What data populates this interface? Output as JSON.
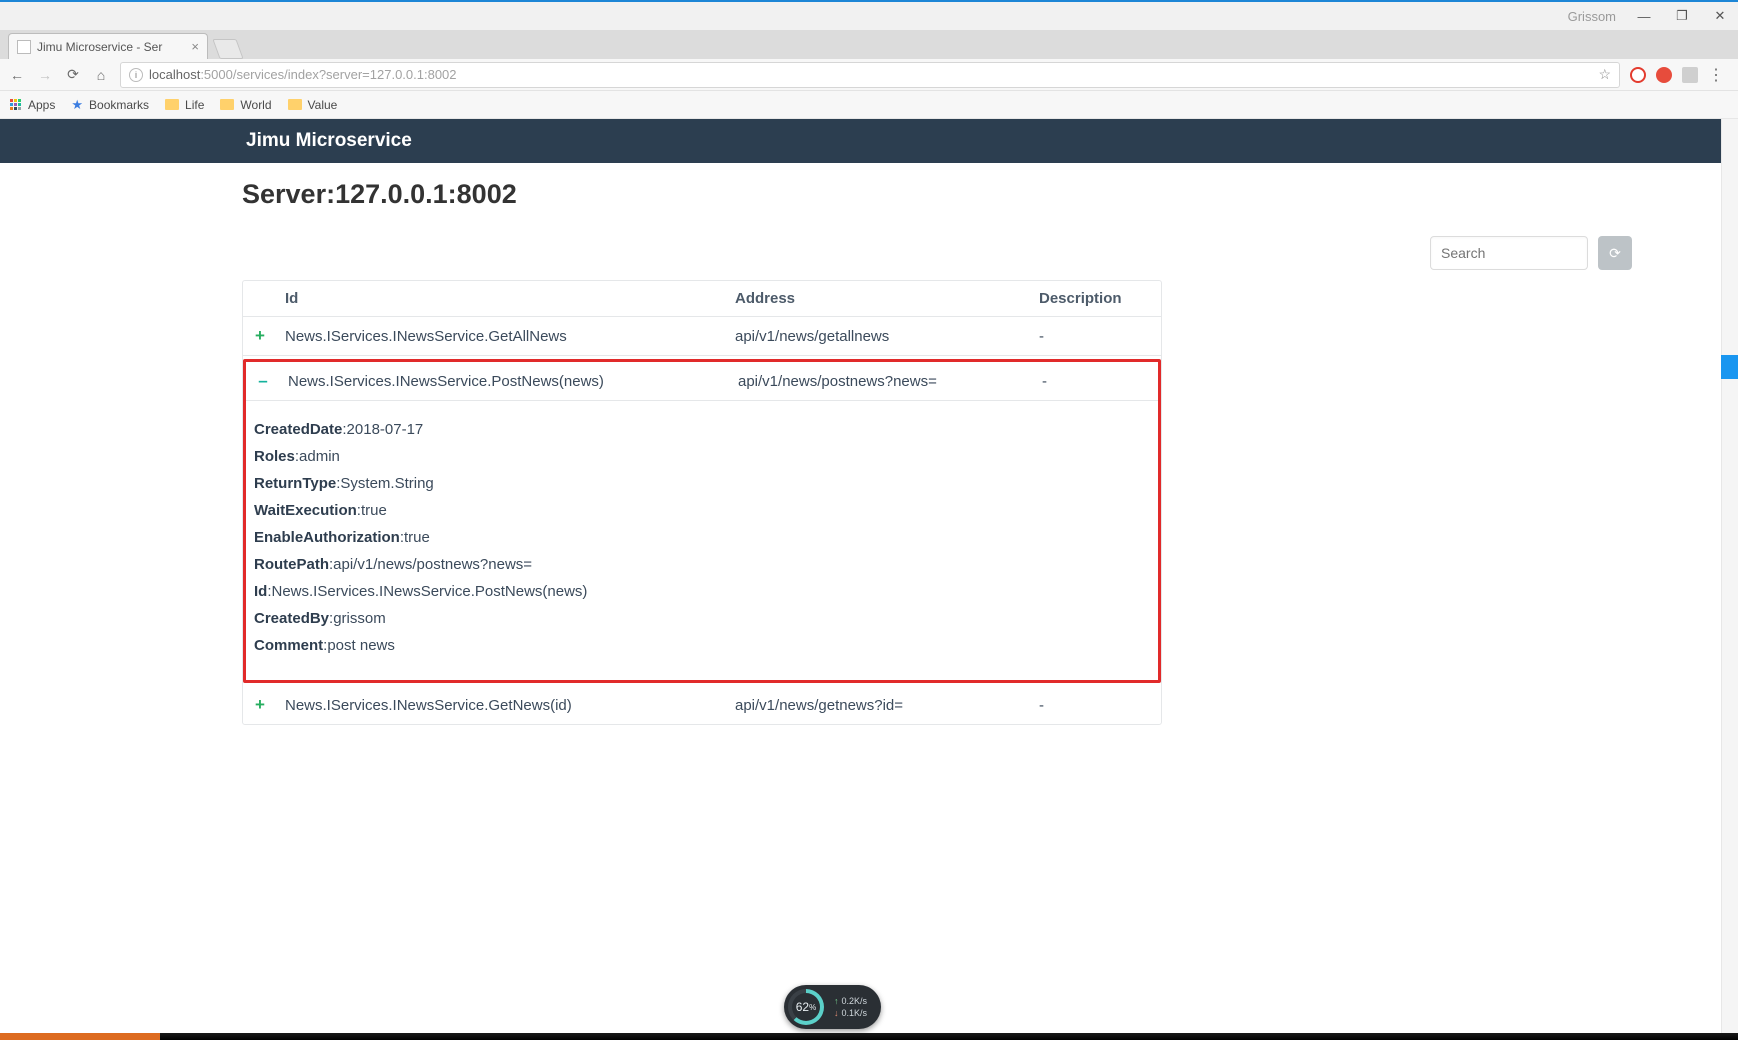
{
  "window": {
    "user": "Grissom",
    "min": "—",
    "max": "❐",
    "close": "✕"
  },
  "tab": {
    "title": "Jimu Microservice - Ser"
  },
  "omnibox": {
    "host": "localhost",
    "rest": ":5000/services/index?server=127.0.0.1:8002"
  },
  "bookmarks": {
    "apps": "Apps",
    "bookmarks": "Bookmarks",
    "life": "Life",
    "world": "World",
    "value": "Value"
  },
  "app": {
    "title": "Jimu Microservice",
    "heading": "Server:127.0.0.1:8002",
    "search_placeholder": "Search"
  },
  "table": {
    "headers": {
      "id": "Id",
      "address": "Address",
      "desc": "Description"
    },
    "rows": [
      {
        "id": "News.IServices.INewsService.GetAllNews",
        "address": "api/v1/news/getallnews",
        "desc": "-"
      },
      {
        "id": "News.IServices.INewsService.PostNews(news)",
        "address": "api/v1/news/postnews?news=",
        "desc": "-"
      },
      {
        "id": "News.IServices.INewsService.GetNews(id)",
        "address": "api/v1/news/getnews?id=",
        "desc": "-"
      }
    ]
  },
  "details": [
    {
      "k": "CreatedDate",
      "v": ":2018-07-17"
    },
    {
      "k": "Roles",
      "v": ":admin"
    },
    {
      "k": "ReturnType",
      "v": ":System.String"
    },
    {
      "k": "WaitExecution",
      "v": ":true"
    },
    {
      "k": "EnableAuthorization",
      "v": ":true"
    },
    {
      "k": "RoutePath",
      "v": ":api/v1/news/postnews?news="
    },
    {
      "k": "Id",
      "v": ":News.IServices.INewsService.PostNews(news)"
    },
    {
      "k": "CreatedBy",
      "v": ":grissom"
    },
    {
      "k": "Comment",
      "v": ":post news"
    }
  ],
  "perf": {
    "pct": "62",
    "pct_suffix": "%",
    "up": "0.2K/s",
    "down": "0.1K/s"
  }
}
